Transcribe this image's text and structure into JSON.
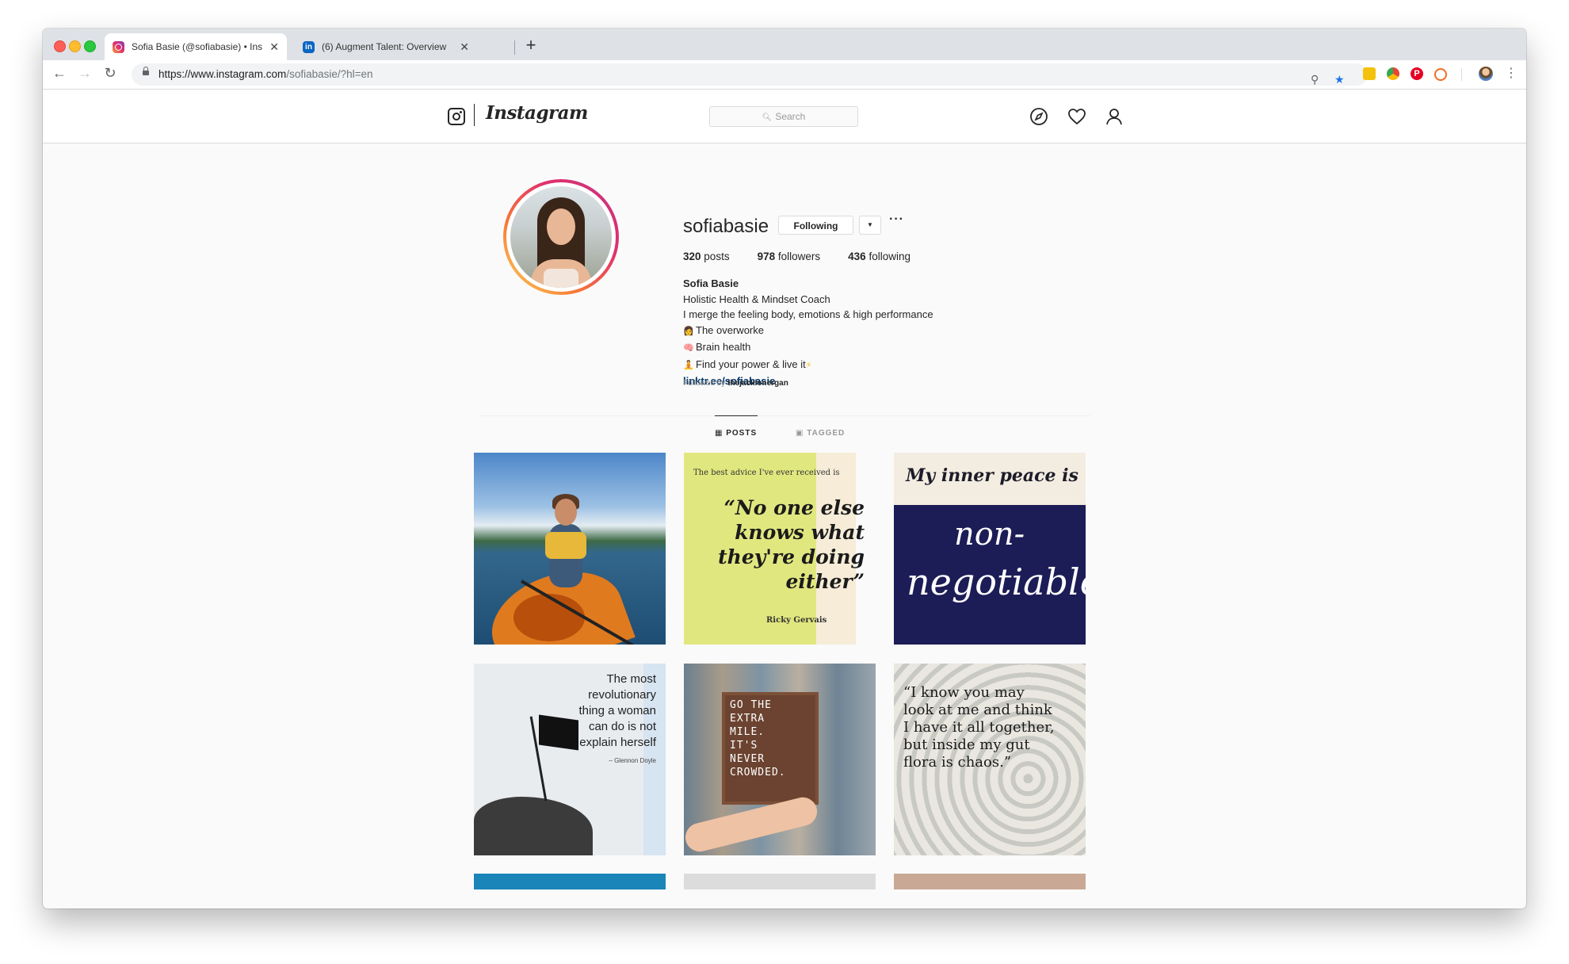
{
  "browser": {
    "tabs": [
      {
        "title": "Sofia Basie (@sofiabasie) • Ins",
        "active": true,
        "favicon": "instagram-icon"
      },
      {
        "title": "(6) Augment Talent: Overview",
        "active": false,
        "favicon": "linkedin-icon"
      }
    ],
    "url": {
      "host": "https://www.instagram.com",
      "path": "/sofiabasie/?hl=en"
    },
    "new_tab_label": "+",
    "pinterest_letter": "P"
  },
  "ig": {
    "wordmark": "Instagram",
    "search_placeholder": "Search"
  },
  "profile": {
    "username": "sofiabasie",
    "following_label": "Following",
    "more_label": "···",
    "posts_count": "320",
    "posts_label": "posts",
    "followers_count": "978",
    "followers_label": "followers",
    "following_count": "436",
    "following_count_label": "following",
    "full_name": "Sofia Basie",
    "bio_lines": [
      "Holistic Health & Mindset Coach",
      "I merge the feeling body, emotions & high performance",
      "The overworke",
      "Brain health",
      "Find your power & live it"
    ],
    "bio_emojis": [
      "👩",
      "🧠",
      "🧘",
      "⚡"
    ],
    "link": "linktr.ee/sofiabasie",
    "followed_by_label": "Followed by",
    "followed_by_user": "thejacklonergan"
  },
  "tabs": [
    {
      "label": "POSTS",
      "active": true
    },
    {
      "label": "TAGGED",
      "active": false
    }
  ],
  "posts": {
    "p2": {
      "small": "The best advice I've ever received is",
      "quote": "“No one else knows what they're doing either”",
      "attribution": "Ricky Gervais"
    },
    "p3": {
      "headline": "My inner peace is",
      "word1": "non-",
      "word2": "negotiable"
    },
    "p4": {
      "quote_lines": [
        "The most",
        "revolutionary",
        "thing a woman",
        "can do is not",
        "explain herself"
      ],
      "attribution": "– Glennon Doyle"
    },
    "p5": {
      "board_lines": [
        "GO THE",
        "EXTRA",
        "MILE.",
        "IT'S",
        "NEVER",
        "CROWDED."
      ]
    },
    "p6": {
      "quote_lines": [
        "“I know you may",
        "look at me and think",
        "I have it all together,",
        "but inside my gut",
        "flora is chaos.”"
      ]
    }
  },
  "colors": {
    "ig_link": "#003569",
    "avatar_ring": [
      "#fdd75a",
      "#f77737",
      "#e1306c",
      "#c13584"
    ]
  }
}
